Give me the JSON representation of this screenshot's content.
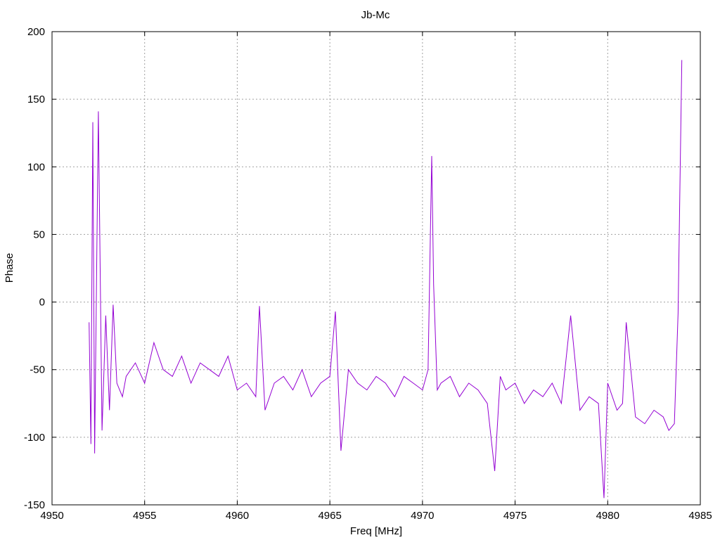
{
  "chart_data": {
    "type": "line",
    "title": "Jb-Mc",
    "xlabel": "Freq [MHz]",
    "ylabel": "Phase",
    "xlim": [
      4950,
      4985
    ],
    "ylim": [
      -150,
      200
    ],
    "xticks": [
      4950,
      4955,
      4960,
      4965,
      4970,
      4975,
      4980,
      4985
    ],
    "yticks": [
      -150,
      -100,
      -50,
      0,
      50,
      100,
      150,
      200
    ],
    "grid": true,
    "series_color": "#9400d3",
    "series": [
      {
        "x": [
          4952.0,
          4952.1,
          4952.2,
          4952.3,
          4952.5,
          4952.7,
          4952.9,
          4953.1,
          4953.3,
          4953.5,
          4953.8,
          4954.0,
          4954.5,
          4955.0,
          4955.5,
          4956.0,
          4956.5,
          4957.0,
          4957.5,
          4958.0,
          4958.5,
          4959.0,
          4959.5,
          4960.0,
          4960.5,
          4961.0,
          4961.2,
          4961.5,
          4962.0,
          4962.5,
          4963.0,
          4963.5,
          4964.0,
          4964.5,
          4965.0,
          4965.3,
          4965.6,
          4966.0,
          4966.5,
          4967.0,
          4967.5,
          4968.0,
          4968.5,
          4969.0,
          4969.5,
          4970.0,
          4970.3,
          4970.5,
          4970.6,
          4970.8,
          4971.0,
          4971.5,
          4972.0,
          4972.5,
          4973.0,
          4973.5,
          4973.9,
          4974.2,
          4974.5,
          4975.0,
          4975.5,
          4976.0,
          4976.5,
          4977.0,
          4977.5,
          4978.0,
          4978.5,
          4979.0,
          4979.5,
          4979.8,
          4980.0,
          4980.5,
          4980.8,
          4981.0,
          4981.5,
          4982.0,
          4982.5,
          4983.0,
          4983.3,
          4983.6,
          4983.8,
          4983.9,
          4984.0
        ],
        "y": [
          -15,
          -105,
          133,
          -112,
          141,
          -95,
          -10,
          -80,
          -2,
          -60,
          -70,
          -55,
          -45,
          -60,
          -30,
          -50,
          -55,
          -40,
          -60,
          -45,
          -50,
          -55,
          -40,
          -65,
          -60,
          -70,
          -3,
          -80,
          -60,
          -55,
          -65,
          -50,
          -70,
          -60,
          -55,
          -7,
          -110,
          -50,
          -60,
          -65,
          -55,
          -60,
          -70,
          -55,
          -60,
          -65,
          -50,
          108,
          13,
          -65,
          -60,
          -55,
          -70,
          -60,
          -65,
          -75,
          -125,
          -55,
          -65,
          -60,
          -75,
          -65,
          -70,
          -60,
          -75,
          -10,
          -80,
          -70,
          -75,
          -145,
          -60,
          -80,
          -75,
          -15,
          -85,
          -90,
          -80,
          -85,
          -95,
          -90,
          -8,
          85,
          179
        ]
      }
    ]
  }
}
